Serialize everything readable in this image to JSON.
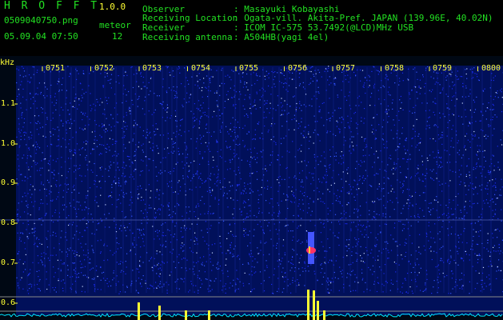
{
  "app": {
    "title": "H R O F F T",
    "version": "1.0.0"
  },
  "file": {
    "name": "0509040750.png",
    "datetime": "05.09.04 07:50"
  },
  "meteor": {
    "label": "meteor",
    "count": "12"
  },
  "info": {
    "observer_label": "Observer",
    "observer_value": ": Masayuki Kobayashi",
    "location_label": "Receiving Location",
    "location_value": ": Ogata-vill. Akita-Pref. JAPAN (139.96E, 40.02N)",
    "receiver_label": "Receiver",
    "receiver_value": ": ICOM IC-575 53.7492(@LCD)MHz USB",
    "antenna_label": "Receiving antenna",
    "antenna_value": ": A504HB(yagi 4el)"
  },
  "axis": {
    "unit": "kHz",
    "y_ticks": [
      "1.1",
      "1.0",
      "0.9",
      "0.8",
      "0.7",
      "0.6"
    ],
    "time_ticks": [
      "0751",
      "0752",
      "0753",
      "0754",
      "0755",
      "0756",
      "0757",
      "0758",
      "0759",
      "0800"
    ]
  },
  "colors": {
    "text": "#22e022",
    "accent": "#ffff33",
    "background": "#000000",
    "noise": "#1a2aff",
    "echo": "#ff3366",
    "level": "#00e5ff"
  }
}
